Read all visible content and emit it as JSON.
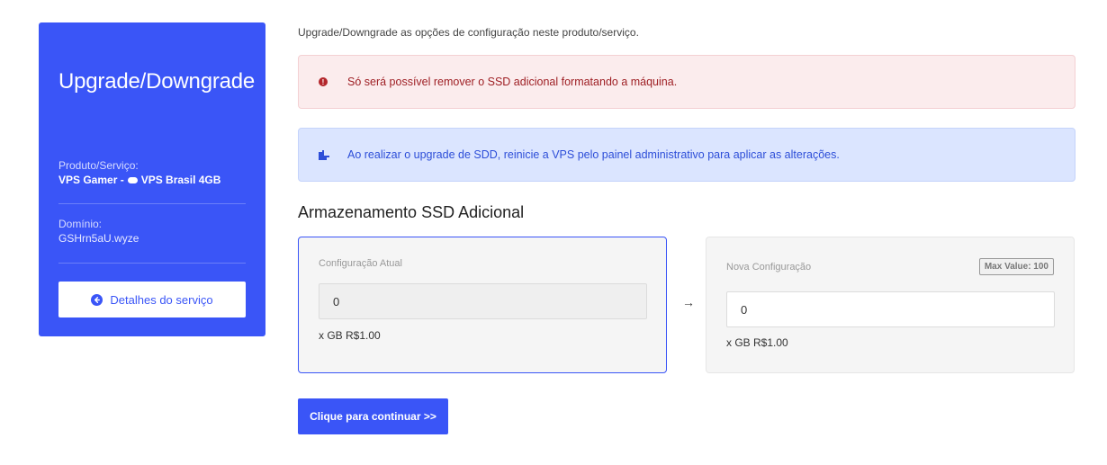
{
  "sidebar": {
    "title": "Upgrade/Downgrade",
    "product_label": "Produto/Serviço:",
    "product_group": "VPS Gamer -",
    "product_name": "VPS Brasil 4GB",
    "domain_label": "Domínio:",
    "domain_value": "GSHrn5aU.wyze",
    "details_button": "Detalhes do serviço"
  },
  "main": {
    "intro": "Upgrade/Downgrade as opções de configuração neste produto/serviço.",
    "alert_danger": "Só será possível remover o SSD adicional formatando a máquina.",
    "alert_info": "Ao realizar o upgrade de SDD, reinicie a VPS pelo painel administrativo para aplicar as alterações.",
    "section_title": "Armazenamento SSD Adicional",
    "current": {
      "label": "Configuração Atual",
      "value": "0",
      "price": "x GB R$1.00"
    },
    "arrow": "→",
    "new": {
      "label": "Nova Configuração",
      "max_badge": "Max Value: 100",
      "value": "0",
      "price": "x GB R$1.00"
    },
    "continue_button": "Clique para continuar >>"
  },
  "colors": {
    "primary": "#3a55f7",
    "danger_bg": "#fbeced",
    "danger_text": "#9e1f24",
    "info_bg": "#dbe5ff",
    "info_text": "#2d4ed8"
  },
  "icons": [
    "info-circle-icon",
    "external-link-icon",
    "cloud-icon",
    "arrow-circle-left-icon",
    "arrow-right-icon"
  ]
}
